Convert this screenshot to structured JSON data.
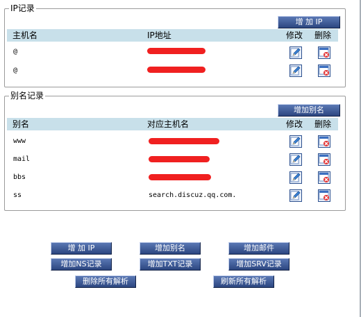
{
  "ip_section": {
    "title": "IP记录",
    "add_button": "增 加 IP",
    "headers": {
      "host": "主机名",
      "ip": "IP地址",
      "edit": "修改",
      "delete": "删除"
    },
    "rows": [
      {
        "host": "@",
        "ip": ""
      },
      {
        "host": "@",
        "ip": ""
      }
    ]
  },
  "alias_section": {
    "title": "别名记录",
    "add_button": "增加别名",
    "headers": {
      "alias": "别名",
      "target": "对应主机名",
      "edit": "修改",
      "delete": "删除"
    },
    "rows": [
      {
        "alias": "www",
        "target": ""
      },
      {
        "alias": "mail",
        "target": ""
      },
      {
        "alias": "bbs",
        "target": ""
      },
      {
        "alias": "ss",
        "target": "search.discuz.qq.com."
      }
    ]
  },
  "bottom_buttons": {
    "add_ip": "增 加 IP",
    "add_alias": "增加别名",
    "add_mail": "增加邮件",
    "add_ns": "增加NS记录",
    "add_txt": "增加TXT记录",
    "add_srv": "增加SRV记录",
    "delete_all": "删除所有解析",
    "refresh_all": "刷新所有解析"
  },
  "icons": {
    "edit": "edit-pencil-icon",
    "delete": "delete-x-icon"
  },
  "colors": {
    "button": "#3a5898",
    "header_bg": "#c8e0ea",
    "redaction": "#f02020"
  }
}
